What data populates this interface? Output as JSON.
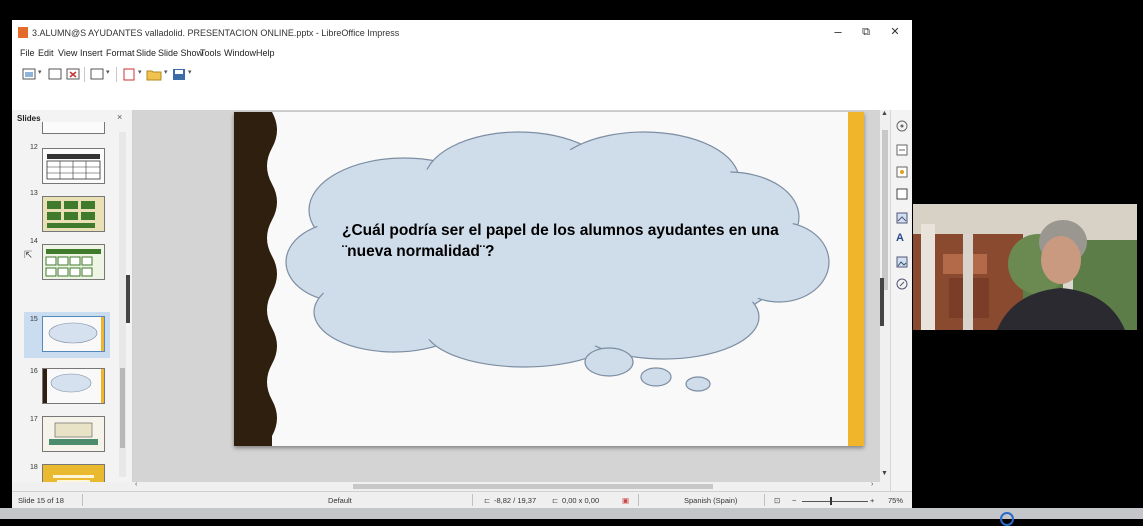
{
  "window": {
    "title": "3.ALUMN@S AYUDANTES valladolid. PRESENTACION ONLINE.pptx - LibreOffice Impress",
    "minimize_glyph": "–",
    "maximize_glyph": "⧉",
    "close_glyph": "✕"
  },
  "menu": {
    "items": [
      "File",
      "Edit",
      "View",
      "Insert",
      "Format",
      "Slide",
      "Slide Show",
      "Tools",
      "Window",
      "Help"
    ]
  },
  "slides_panel": {
    "title": "Slides",
    "close_glyph": "×",
    "thumbnails": [
      {
        "number": "12",
        "style": "table"
      },
      {
        "number": "13",
        "style": "green-grid"
      },
      {
        "number": "14",
        "style": "green-boxes"
      },
      {
        "number": "15",
        "style": "cloud",
        "selected": true
      },
      {
        "number": "16",
        "style": "cloud-gold"
      },
      {
        "number": "17",
        "style": "banner"
      },
      {
        "number": "18",
        "style": "gold"
      }
    ]
  },
  "slide": {
    "text": "¿Cuál podría ser el papel de los alumnos ayudantes en una ¨nueva normalidad¨?",
    "accent_color": "#f0b52b",
    "border_color": "#2f1f0e",
    "cloud_color": "#cfdcea"
  },
  "sidebar": {
    "icons": [
      "properties-icon",
      "styles-icon",
      "gallery-icon",
      "navigator-icon",
      "slide-transition-icon",
      "animation-icon",
      "master-slides-icon",
      "shapes-icon"
    ]
  },
  "statusbar": {
    "slide_position": "Slide 15 of 18",
    "master": "Default",
    "cursor_position": "-8,82 / 19,37",
    "object_size": "0,00 x 0,00",
    "language": "Spanish (Spain)",
    "zoom": "75%",
    "zoom_minus": "−",
    "zoom_plus": "+"
  }
}
